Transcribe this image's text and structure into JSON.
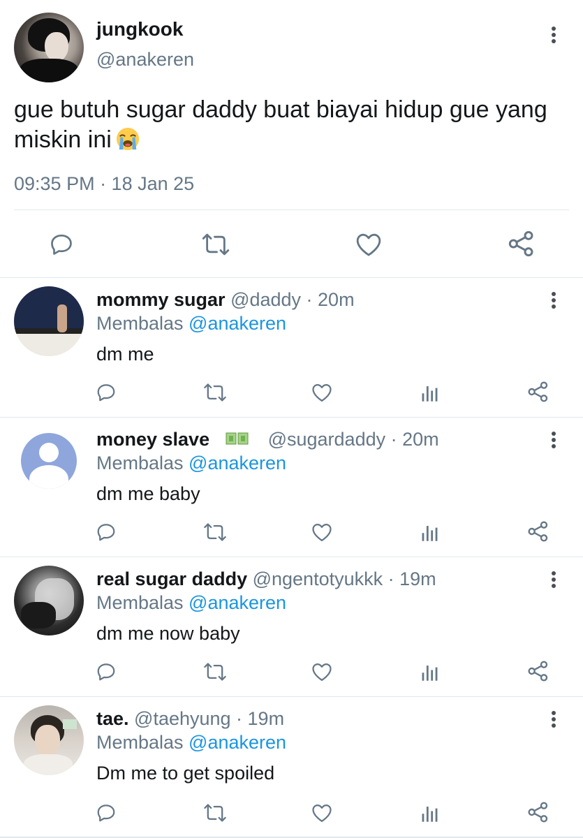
{
  "main_tweet": {
    "name": "jungkook",
    "handle": "@anakeren",
    "text": "gue butuh sugar daddy buat biayai hidup gue yang miskin ini",
    "emoji": "loudly-crying-face",
    "time": "09:35 PM · 18 Jan 25",
    "actions": [
      "reply-icon",
      "retweet-icon",
      "like-icon",
      "share-icon"
    ]
  },
  "replies": [
    {
      "name": "mommy sugar",
      "handle": "@daddy",
      "meta": " @daddy · 20m",
      "reply_label": "Membalas ",
      "reply_to": "@anakeren",
      "text": "dm me"
    },
    {
      "name": "money slave",
      "handle": "@sugardaddy",
      "meta": " @sugardaddy · 20m",
      "name_emoji": "money-with-wings",
      "reply_label": "Membalas ",
      "reply_to": "@anakeren",
      "text": "dm me baby"
    },
    {
      "name": "real sugar daddy",
      "handle": "@ngentotyukkk",
      "meta": " @ngentotyukkk · 19m",
      "reply_label": "Membalas ",
      "reply_to": "@anakeren",
      "text": "dm me now baby"
    },
    {
      "name": "tae.",
      "handle": "@taehyung",
      "meta": " @taehyung · 19m",
      "reply_label": "Membalas ",
      "reply_to": "@anakeren",
      "text": "Dm me to get spoiled"
    }
  ],
  "reply_actions": [
    "reply-icon",
    "retweet-icon",
    "like-icon",
    "analytics-icon",
    "share-icon"
  ],
  "colors": {
    "text": "#14171a",
    "secondary": "#657786",
    "link": "#1b95e0",
    "divider": "#e1e8ed",
    "icon": "#657786"
  }
}
